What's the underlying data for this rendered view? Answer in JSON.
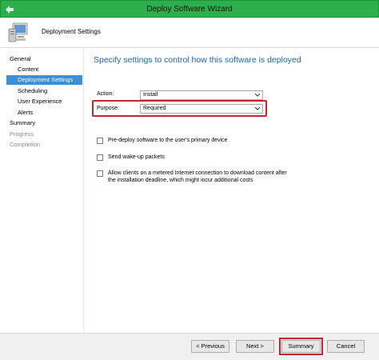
{
  "window": {
    "title": "Deploy Software Wizard"
  },
  "header": {
    "title": "Deployment Settings"
  },
  "nav": {
    "items": [
      {
        "label": "General"
      },
      {
        "label": "Content"
      },
      {
        "label": "Deployment Settings"
      },
      {
        "label": "Scheduling"
      },
      {
        "label": "User Experience"
      },
      {
        "label": "Alerts"
      },
      {
        "label": "Summary"
      },
      {
        "label": "Progress"
      },
      {
        "label": "Completion"
      }
    ]
  },
  "main": {
    "heading": "Specify settings to control how this software is deployed",
    "action": {
      "label": "Action:",
      "value": "Install"
    },
    "purpose": {
      "label": "Purpose:",
      "value": "Required"
    },
    "options": [
      {
        "label": "Pre-deploy software to the user's primary device",
        "checked": false
      },
      {
        "label": "Send wake-up packets",
        "checked": false
      },
      {
        "label": "Allow clients on a metered Internet connection to download content after the installation deadline, which might incur additional costs",
        "checked": false
      }
    ]
  },
  "footer": {
    "previous": "< Previous",
    "next": "Next >",
    "summary": "Summary",
    "cancel": "Cancel"
  },
  "colors": {
    "accent": "#3a8fd6",
    "titlebar": "#2bb04b",
    "heading": "#1a66b5",
    "highlight": "#c1272d"
  }
}
